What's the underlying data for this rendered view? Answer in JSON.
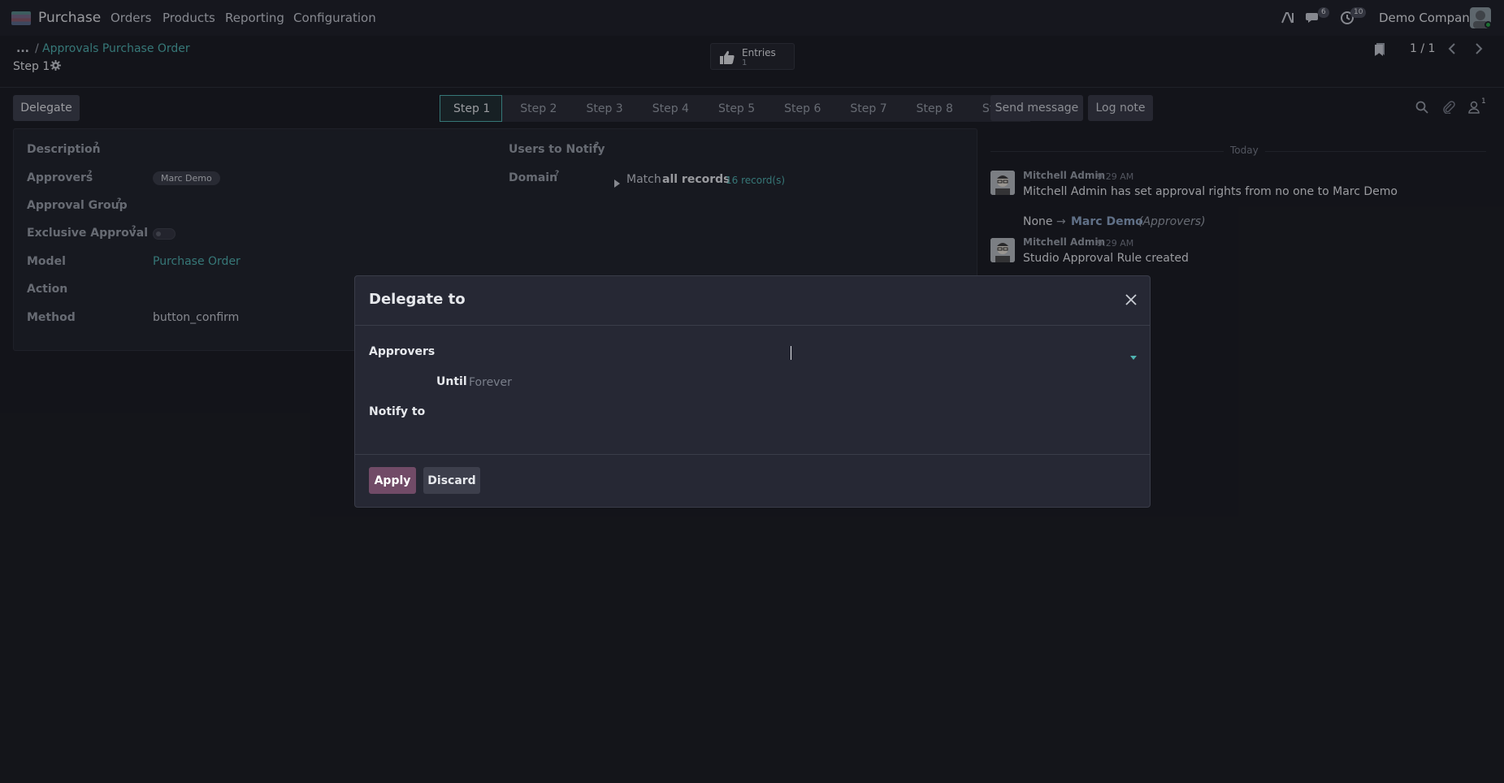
{
  "topnav": {
    "brand": "Purchase",
    "menu": [
      "Orders",
      "Products",
      "Reporting",
      "Configuration"
    ],
    "messages_badge": "6",
    "activity_badge": "10",
    "company": "Demo Company",
    "icons": [
      "apps-icon",
      "ai-icon",
      "chat-icon",
      "clock-icon",
      "avatar"
    ]
  },
  "breadcrumb": {
    "ellipsis": "...",
    "separator": "/",
    "parent": "Approvals Purchase Order",
    "current": "Step 1"
  },
  "entries": {
    "label": "Entries",
    "count": "1"
  },
  "pager": {
    "value": "1 / 1"
  },
  "actions": {
    "delegate": "Delegate"
  },
  "statusbar": {
    "steps": [
      "Step 1",
      "Step 2",
      "Step 3",
      "Step 4",
      "Step 5",
      "Step 6",
      "Step 7",
      "Step 8",
      "Step 9"
    ],
    "active_index": 0
  },
  "form": {
    "description_label": "Description",
    "approvers_label": "Approvers",
    "approvers_tag": "Marc Demo",
    "approval_group_label": "Approval Group",
    "exclusive_label": "Exclusive Approval",
    "model_label": "Model",
    "model_value": "Purchase Order",
    "action_label": "Action",
    "method_label": "Method",
    "method_value": "button_confirm",
    "users_notify_label": "Users to Notify",
    "domain_label": "Domain",
    "domain_match": "Match",
    "domain_all": "all records",
    "domain_records": "16 record(s)",
    "help_mark": "?"
  },
  "chatter": {
    "send_message": "Send message",
    "log_note": "Log note",
    "followers_count": "1",
    "today": "Today",
    "messages": [
      {
        "author": "Mitchell Admin",
        "time": "9:29 AM",
        "body": "Mitchell Admin has set approval rights from no one to Marc Demo",
        "tracking_old": "None",
        "tracking_arrow": "→",
        "tracking_new": "Marc Demo",
        "tracking_field": "(Approvers)"
      },
      {
        "author": "Mitchell Admin",
        "time": "9:29 AM",
        "body": "Studio Approval Rule created"
      }
    ]
  },
  "dialog": {
    "title": "Delegate to",
    "approvers_label": "Approvers",
    "until_label": "Until",
    "until_placeholder": "Forever",
    "notify_label": "Notify to",
    "apply": "Apply",
    "discard": "Discard"
  },
  "colors": {
    "accent": "#4fb3b0",
    "primary": "#714b67",
    "background": "#1a1b21"
  }
}
